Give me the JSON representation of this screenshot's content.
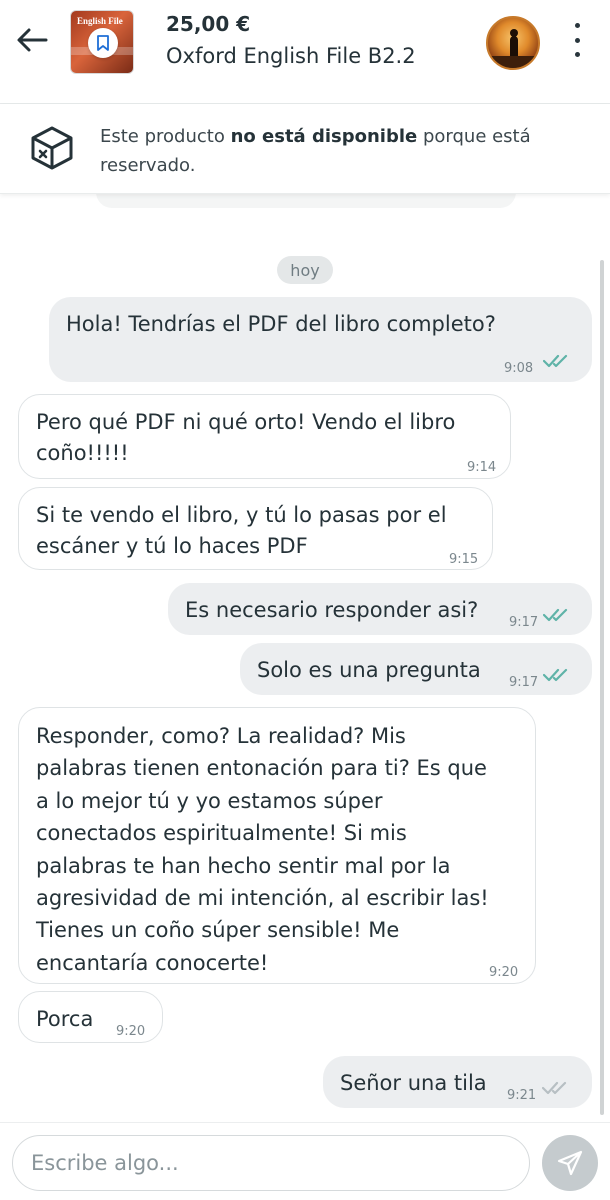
{
  "header": {
    "price": "25,00 €",
    "title": "Oxford English File B2.2",
    "cover_text": "English File",
    "icons": {
      "back": "arrow-left-icon",
      "bookmark": "bookmark-icon",
      "more": "more-vertical-icon"
    }
  },
  "notice": {
    "before": "Este producto ",
    "bold": "no está disponible",
    "after": " porque está reservado.",
    "icon": "box-unavailable-icon"
  },
  "day_chip": "hoy",
  "messages": [
    {
      "dir": "out",
      "text": "Hola! Tendrías el PDF del libro completo?",
      "time": "9:08",
      "status": "read"
    },
    {
      "dir": "in",
      "text": "Pero qué PDF ni qué orto! Vendo el libro\ncoño!!!!!",
      "time": "9:14"
    },
    {
      "dir": "in",
      "text": "Si te vendo el libro, y tú lo pasas por el\nescáner y tú lo haces PDF",
      "time": "9:15"
    },
    {
      "dir": "out",
      "text": "Es necesario responder asi?",
      "time": "9:17",
      "status": "read"
    },
    {
      "dir": "out",
      "text": "Solo es una pregunta",
      "time": "9:17",
      "status": "read"
    },
    {
      "dir": "in",
      "text": "Responder, como? La realidad? Mis\npalabras tienen entonación para ti? Es que\na lo mejor tú y yo estamos súper\nconectados espiritualmente! Si mis\npalabras te han hecho sentir mal por la\nagresividad de mi intención, al escribir las!\nTienes un coño súper sensible! Me\nencantaría conocerte!",
      "time": "9:20"
    },
    {
      "dir": "in",
      "text": "Porca",
      "time": "9:20"
    },
    {
      "dir": "out",
      "text": "Señor una tila",
      "time": "9:21",
      "status": "delivered"
    }
  ],
  "composer": {
    "placeholder": "Escribe algo...",
    "send_icon": "send-icon"
  },
  "colors": {
    "read_check": "#5fb3a8",
    "delivered_check": "#b7bfc3",
    "out_bubble": "#eceef0"
  }
}
